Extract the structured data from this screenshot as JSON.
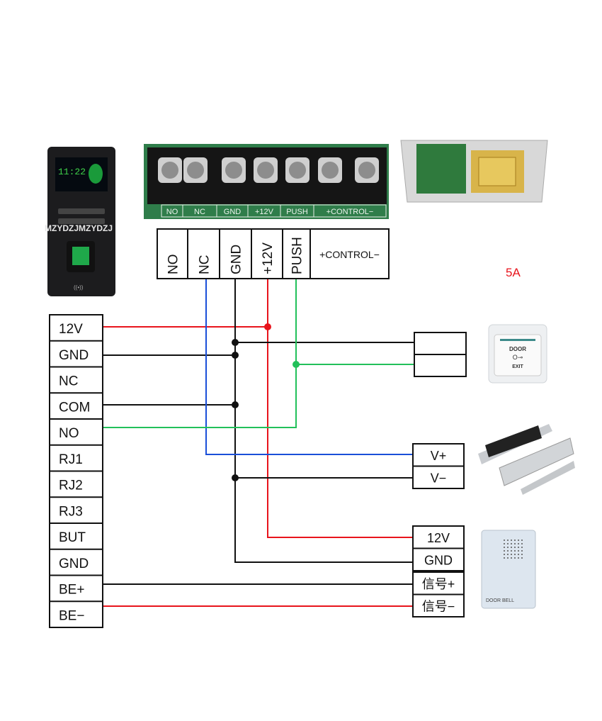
{
  "controller_terminals": [
    "12V",
    "GND",
    "NC",
    "COM",
    "NO",
    "RJ1",
    "RJ2",
    "RJ3",
    "BUT",
    "GND",
    "BE+",
    "BE−"
  ],
  "power_supply_terminals": [
    "NO",
    "NC",
    "GND",
    "+12V",
    "PUSH",
    "+CONTROL−"
  ],
  "board_silkscreen": [
    "NO",
    "NC",
    "GND",
    "+12V",
    "PUSH",
    "+CONTROL−"
  ],
  "power_rating": "5A",
  "lock_terminals": [
    "V+",
    "V−"
  ],
  "doorbell_terminals": [
    "12V",
    "GND",
    "信号+",
    "信号−"
  ],
  "exit_button": {
    "line1": "DOOR",
    "line2": "EXIT"
  },
  "doorbell_label": "DOOR BELL",
  "device_clock": "11:22",
  "watermark": "MZYDZJMZYDZJ",
  "wire_colors": {
    "red": "#e8141c",
    "black": "#111111",
    "blue": "#1a4fd8",
    "green": "#22c05a"
  }
}
